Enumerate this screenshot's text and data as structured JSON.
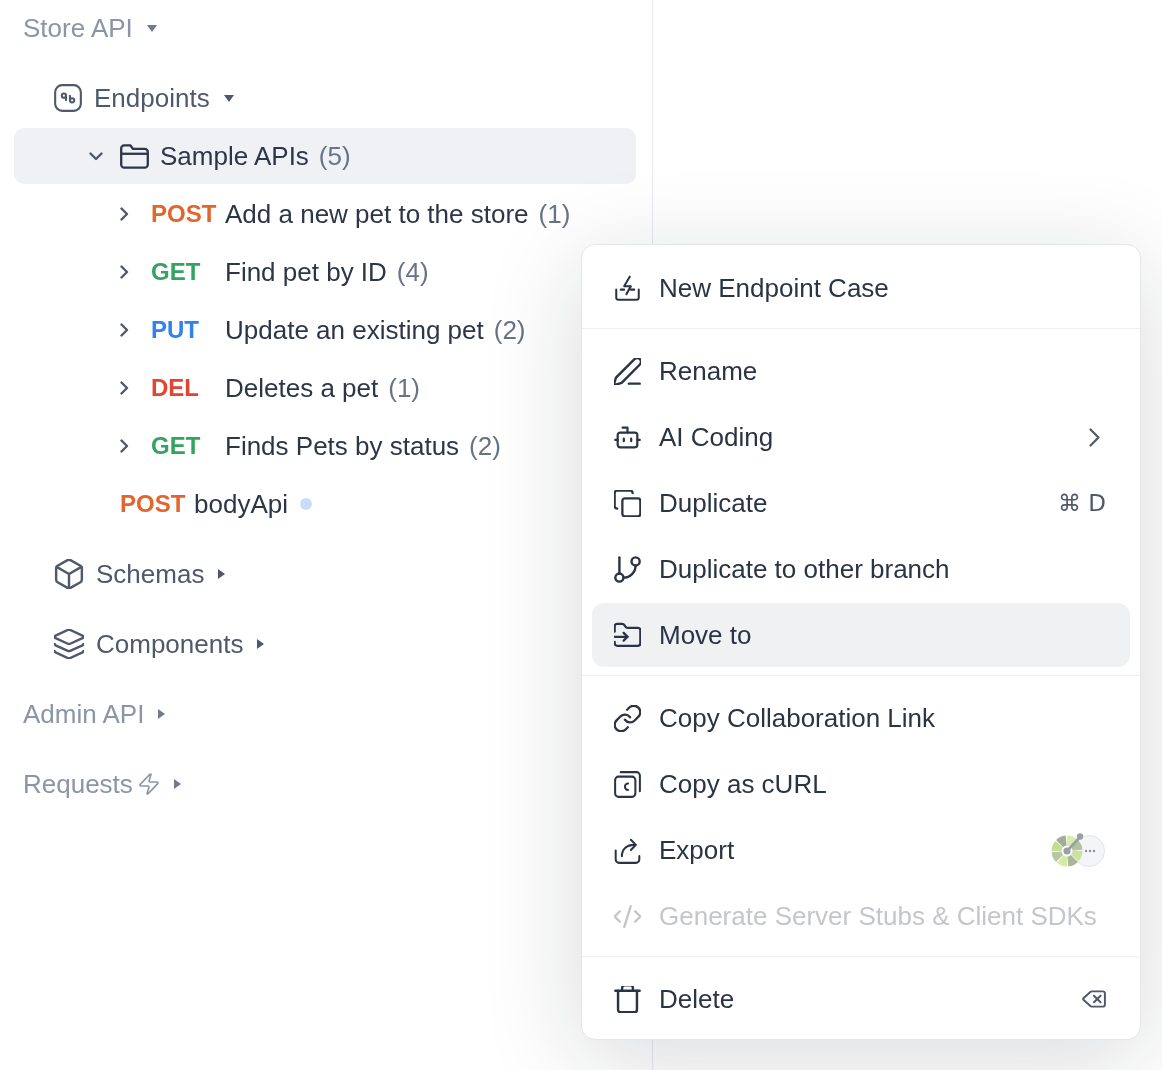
{
  "sidebar": {
    "sections": [
      {
        "kind": "api",
        "label": "Store API",
        "expanded": true,
        "selected": false,
        "children": [
          {
            "kind": "endpoints",
            "label": "Endpoints",
            "expanded": true,
            "selected": false,
            "children": [
              {
                "kind": "folder",
                "label": "Sample APIs",
                "count": "(5)",
                "expanded": true,
                "selected": true,
                "children": [
                  {
                    "kind": "endpoint",
                    "method": "POST",
                    "color": "#e4652c",
                    "label": "Add a new pet to the store",
                    "count": "(1)",
                    "expanded": false,
                    "selected": false,
                    "unsaved": false
                  },
                  {
                    "kind": "endpoint",
                    "method": "GET",
                    "color": "#34a35f",
                    "label": "Find pet by ID",
                    "count": "(4)",
                    "expanded": false,
                    "selected": false,
                    "unsaved": false
                  },
                  {
                    "kind": "endpoint",
                    "method": "PUT",
                    "color": "#3182ed",
                    "label": "Update an existing pet",
                    "count": "(2)",
                    "expanded": false,
                    "selected": false,
                    "unsaved": false
                  },
                  {
                    "kind": "endpoint",
                    "method": "DEL",
                    "color": "#e2442f",
                    "label": "Deletes a pet",
                    "count": "(1)",
                    "expanded": false,
                    "selected": false,
                    "unsaved": false
                  },
                  {
                    "kind": "endpoint",
                    "method": "GET",
                    "color": "#34a35f",
                    "label": "Finds Pets by status",
                    "count": "(2)",
                    "expanded": false,
                    "selected": false,
                    "unsaved": false
                  }
                ]
              },
              {
                "kind": "endpoint",
                "method": "POST",
                "color": "#e4652c",
                "label": "bodyApi",
                "selected": false,
                "unsaved": true
              }
            ]
          },
          {
            "kind": "schemas",
            "label": "Schemas",
            "expanded": false,
            "selected": false
          },
          {
            "kind": "components",
            "label": "Components",
            "expanded": false,
            "selected": false
          }
        ]
      },
      {
        "kind": "api",
        "label": "Admin API",
        "expanded": false,
        "selected": false
      },
      {
        "kind": "requests",
        "label": "Requests",
        "expanded": false,
        "selected": false
      }
    ]
  },
  "context_menu": {
    "groups": [
      {
        "items": [
          {
            "kind": "plain",
            "label": "New Endpoint Case",
            "highlighted": false,
            "disabled": false
          }
        ]
      },
      {
        "items": [
          {
            "kind": "plain",
            "label": "Rename",
            "highlighted": false,
            "disabled": false
          },
          {
            "kind": "submenu",
            "label": "AI Coding",
            "highlighted": false,
            "disabled": false
          },
          {
            "kind": "shortcut",
            "label": "Duplicate",
            "shortcut": "⌘ D",
            "highlighted": false,
            "disabled": false
          },
          {
            "kind": "plain",
            "label": "Duplicate to other branch",
            "highlighted": false,
            "disabled": false
          },
          {
            "kind": "plain",
            "label": "Move to",
            "highlighted": true,
            "disabled": false
          }
        ]
      },
      {
        "items": [
          {
            "kind": "plain",
            "label": "Copy Collaboration Link",
            "highlighted": false,
            "disabled": false
          },
          {
            "kind": "plain",
            "label": "Copy as cURL",
            "highlighted": false,
            "disabled": false
          },
          {
            "kind": "logos",
            "label": "Export",
            "highlighted": false,
            "disabled": false
          },
          {
            "kind": "plain",
            "label": "Generate Server Stubs & Client SDKs",
            "highlighted": false,
            "disabled": true
          }
        ]
      },
      {
        "items": [
          {
            "kind": "key",
            "label": "Delete",
            "highlighted": false,
            "disabled": false
          }
        ]
      }
    ]
  }
}
